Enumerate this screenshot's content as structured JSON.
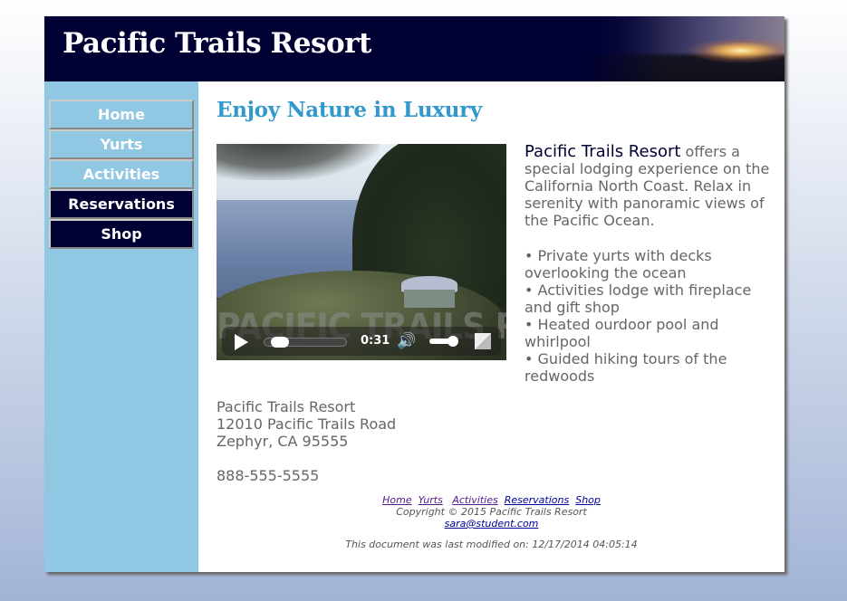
{
  "header": {
    "title": "Pacific Trails Resort"
  },
  "nav": {
    "items": [
      {
        "label": "Home"
      },
      {
        "label": "Yurts"
      },
      {
        "label": "Activities"
      },
      {
        "label": "Reservations"
      },
      {
        "label": "Shop"
      }
    ]
  },
  "main": {
    "heading": "Enjoy Nature in Luxury",
    "video": {
      "watermark": "PACIFIC TRAILS RESORT",
      "time": "0:31",
      "progress_fraction": 0.1,
      "volume_fraction": 1.0
    },
    "intro": {
      "brand": "Pacific Trails Resort",
      "text": " offers a special lodging experience on the California North Coast. Relax in serenity with panoramic views of the Pacific Ocean."
    },
    "features": [
      "Private yurts with decks overlooking the ocean",
      "Activities lodge with fireplace and gift shop",
      "Heated ourdoor pool and whirlpool",
      "Guided hiking tours of the redwoods"
    ],
    "contact": {
      "name": "Pacific Trails Resort",
      "street": "12010 Pacific Trails Road",
      "city": "Zephyr, CA 95555",
      "phone": "888-555-5555"
    }
  },
  "footer": {
    "links": [
      {
        "label": "Home"
      },
      {
        "label": "Yurts"
      },
      {
        "label": "Activities"
      },
      {
        "label": "Reservations"
      },
      {
        "label": "Shop"
      }
    ],
    "copyright": "Copyright © 2015 Pacific Trails Resort",
    "email": "sara@student.com",
    "modified": "This document was last modified on: 12/17/2014 04:05:14"
  }
}
